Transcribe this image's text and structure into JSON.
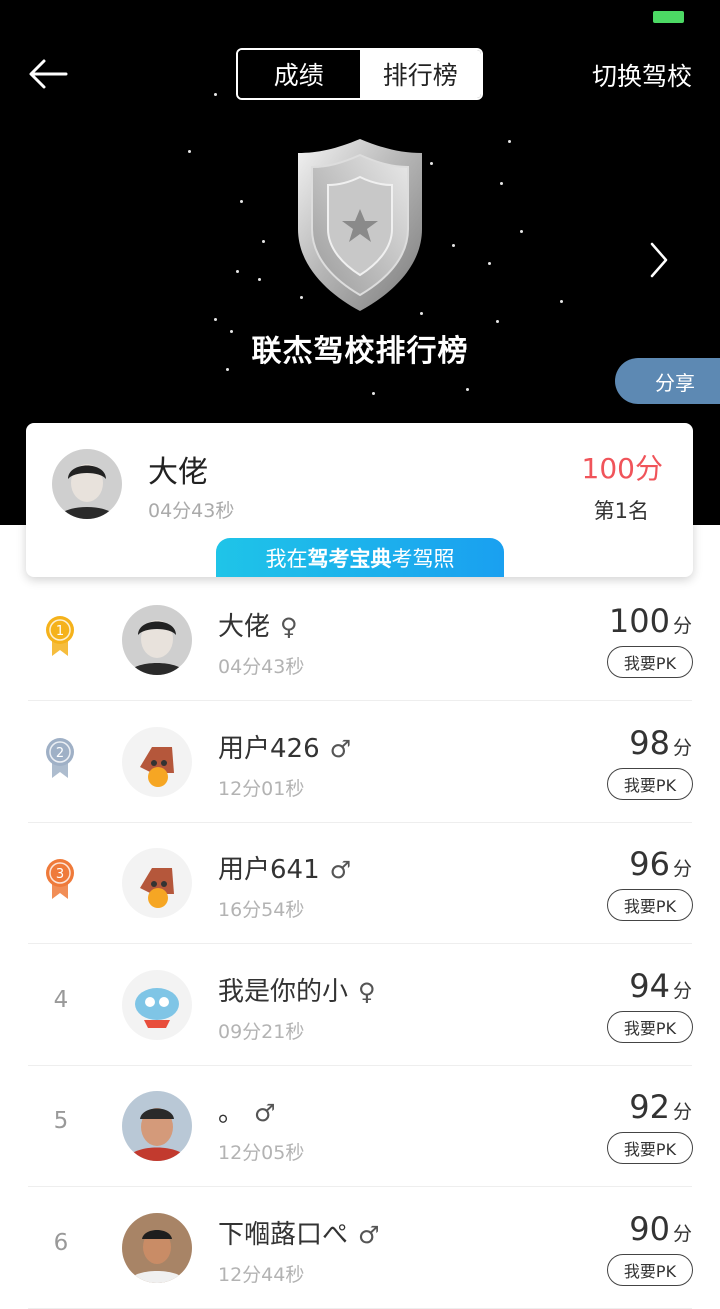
{
  "header": {
    "tab_scores": "成绩",
    "tab_ranking": "排行榜",
    "switch_school": "切换驾校",
    "title": "联杰驾校排行榜",
    "share": "分享"
  },
  "my_card": {
    "name": "大佬",
    "time": "04分43秒",
    "score": "100分",
    "rank": "第1名",
    "banner_prefix": "我在",
    "banner_brand": "驾考宝典",
    "banner_suffix": "考驾照"
  },
  "pk_label": "我要PK",
  "score_unit": "分",
  "colors": {
    "accent_red": "#f0545a",
    "share_bg": "#5d89b3",
    "banner_start": "#1fc4e8",
    "banner_end": "#1aa0f0",
    "gold": "#f5b21b",
    "silver": "#9fb0c6",
    "bronze": "#ef7a3a"
  },
  "rows": [
    {
      "rank": "1",
      "medal": "gold",
      "name": "大佬",
      "gender": "♀",
      "time": "04分43秒",
      "score": "100"
    },
    {
      "rank": "2",
      "medal": "silver",
      "name": "用户426",
      "gender": "♂",
      "time": "12分01秒",
      "score": "98"
    },
    {
      "rank": "3",
      "medal": "bronze",
      "name": "用户641",
      "gender": "♂",
      "time": "16分54秒",
      "score": "96"
    },
    {
      "rank": "4",
      "medal": "",
      "name": "我是你的小",
      "gender": "♀",
      "time": "09分21秒",
      "score": "94"
    },
    {
      "rank": "5",
      "medal": "",
      "name": "。",
      "gender": "♂",
      "time": "12分05秒",
      "score": "92"
    },
    {
      "rank": "6",
      "medal": "",
      "name": "下嗰蕗口ぺ",
      "gender": "♂",
      "time": "12分44秒",
      "score": "90"
    }
  ]
}
